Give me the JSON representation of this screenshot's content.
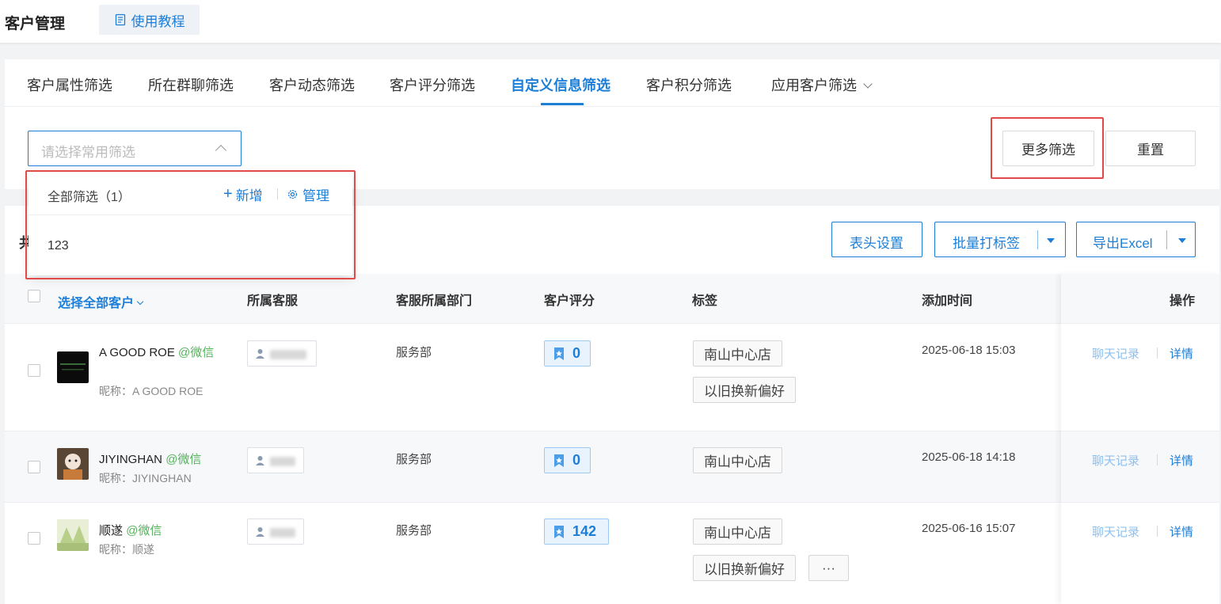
{
  "header": {
    "title": "客户管理",
    "tutorial_label": "使用教程"
  },
  "filter_tabs": [
    {
      "label": "客户属性筛选",
      "active": false
    },
    {
      "label": "所在群聊筛选",
      "active": false
    },
    {
      "label": "客户动态筛选",
      "active": false
    },
    {
      "label": "客户评分筛选",
      "active": false
    },
    {
      "label": "自定义信息筛选",
      "active": true
    },
    {
      "label": "客户积分筛选",
      "active": false
    },
    {
      "label": "应用客户筛选",
      "active": false
    }
  ],
  "filter": {
    "select_placeholder": "请选择常用筛选",
    "more_label": "更多筛选",
    "reset_label": "重置"
  },
  "dropdown": {
    "title": "全部筛选（1）",
    "add_label": "新增",
    "manage_label": "管理",
    "items": [
      "123"
    ]
  },
  "toolbar": {
    "total_prefix": "共",
    "header_settings_label": "表头设置",
    "batch_tag_label": "批量打标签",
    "export_label": "导出Excel"
  },
  "table": {
    "columns": {
      "select_all": "选择全部客户",
      "agent": "所属客服",
      "department": "客服所属部门",
      "score": "客户评分",
      "tags": "标签",
      "added_time": "添加时间",
      "actions": "操作"
    },
    "rows": [
      {
        "name": "A GOOD ROE",
        "channel": "@微信",
        "nickname": "昵称：A GOOD ROE",
        "department": "服务部",
        "score": "0",
        "tags": [
          "南山中心店",
          "以旧换新偏好"
        ],
        "time": "2025-06-18 15:03",
        "chat_link": "聊天记录",
        "detail_link": "详情"
      },
      {
        "name": "JIYINGHAN",
        "channel": "@微信",
        "nickname": "昵称：JIYINGHAN",
        "department": "服务部",
        "score": "0",
        "tags": [
          "南山中心店"
        ],
        "time": "2025-06-18 14:18",
        "chat_link": "聊天记录",
        "detail_link": "详情"
      },
      {
        "name": "顺遂",
        "channel": "@微信",
        "nickname": "昵称：顺遂",
        "department": "服务部",
        "score": "142",
        "tags": [
          "南山中心店",
          "以旧换新偏好"
        ],
        "more_tags": "···",
        "time": "2025-06-16 15:07",
        "chat_link": "聊天记录",
        "detail_link": "详情"
      }
    ]
  },
  "colors": {
    "accent": "#1c7ed6",
    "wechat_green": "#52b35a",
    "highlight_red": "#e24a4a"
  }
}
